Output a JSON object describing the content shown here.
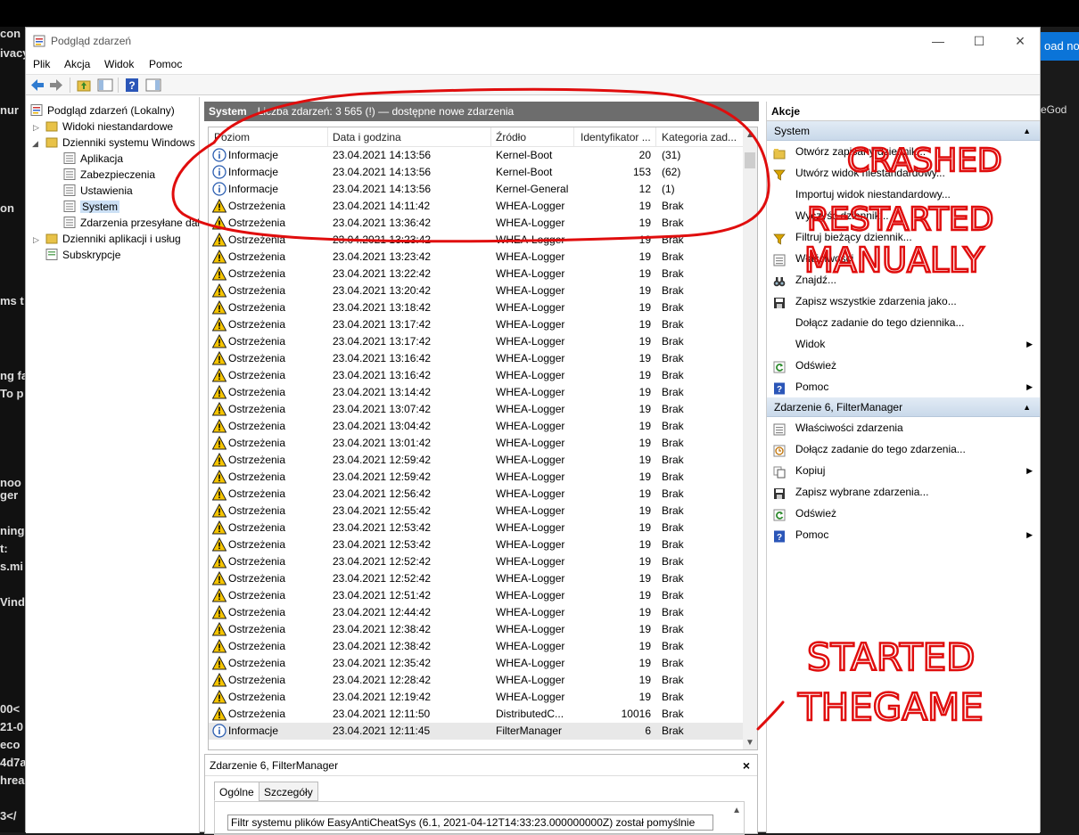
{
  "background": {
    "left_fragments": [
      "con",
      "ivacy",
      "nur",
      "on",
      "ms t",
      "ng fa",
      "To p",
      "noo",
      "ger",
      "ning",
      "t:",
      "s.mi",
      "Vind",
      "00<",
      "21-0",
      "eco",
      "4d7a",
      "hrea",
      "3</"
    ],
    "right_button": "oad no",
    "right_text": "eGod"
  },
  "window": {
    "title": "Podgląd zdarzeń",
    "menu": [
      "Plik",
      "Akcja",
      "Widok",
      "Pomoc"
    ]
  },
  "tree": {
    "root": "Podgląd zdarzeń (Lokalny)",
    "custom_views": "Widoki niestandardowe",
    "windows_logs": "Dzienniki systemu Windows",
    "logs": [
      "Aplikacja",
      "Zabezpieczenia",
      "Ustawienia",
      "System",
      "Zdarzenia przesyłane dalej"
    ],
    "app_logs": "Dzienniki aplikacji i usług",
    "subscriptions": "Subskrypcje"
  },
  "center": {
    "log_name": "System",
    "count_text": "Liczba zdarzeń: 3 565 (!) — dostępne nowe zdarzenia",
    "columns": [
      "Poziom",
      "Data i godzina",
      "Źródło",
      "Identyfikator ...",
      "Kategoria zad..."
    ],
    "rows": [
      {
        "level": "Informacje",
        "type": "info",
        "date": "23.04.2021 14:13:56",
        "source": "Kernel-Boot",
        "id": "20",
        "category": "(31)"
      },
      {
        "level": "Informacje",
        "type": "info",
        "date": "23.04.2021 14:13:56",
        "source": "Kernel-Boot",
        "id": "153",
        "category": "(62)"
      },
      {
        "level": "Informacje",
        "type": "info",
        "date": "23.04.2021 14:13:56",
        "source": "Kernel-General",
        "id": "12",
        "category": "(1)"
      },
      {
        "level": "Ostrzeżenia",
        "type": "warn",
        "date": "23.04.2021 14:11:42",
        "source": "WHEA-Logger",
        "id": "19",
        "category": "Brak"
      },
      {
        "level": "Ostrzeżenia",
        "type": "warn",
        "date": "23.04.2021 13:36:42",
        "source": "WHEA-Logger",
        "id": "19",
        "category": "Brak"
      },
      {
        "level": "Ostrzeżenia",
        "type": "warn",
        "date": "23.04.2021 13:23:42",
        "source": "WHEA-Logger",
        "id": "19",
        "category": "Brak"
      },
      {
        "level": "Ostrzeżenia",
        "type": "warn",
        "date": "23.04.2021 13:23:42",
        "source": "WHEA-Logger",
        "id": "19",
        "category": "Brak"
      },
      {
        "level": "Ostrzeżenia",
        "type": "warn",
        "date": "23.04.2021 13:22:42",
        "source": "WHEA-Logger",
        "id": "19",
        "category": "Brak"
      },
      {
        "level": "Ostrzeżenia",
        "type": "warn",
        "date": "23.04.2021 13:20:42",
        "source": "WHEA-Logger",
        "id": "19",
        "category": "Brak"
      },
      {
        "level": "Ostrzeżenia",
        "type": "warn",
        "date": "23.04.2021 13:18:42",
        "source": "WHEA-Logger",
        "id": "19",
        "category": "Brak"
      },
      {
        "level": "Ostrzeżenia",
        "type": "warn",
        "date": "23.04.2021 13:17:42",
        "source": "WHEA-Logger",
        "id": "19",
        "category": "Brak"
      },
      {
        "level": "Ostrzeżenia",
        "type": "warn",
        "date": "23.04.2021 13:17:42",
        "source": "WHEA-Logger",
        "id": "19",
        "category": "Brak"
      },
      {
        "level": "Ostrzeżenia",
        "type": "warn",
        "date": "23.04.2021 13:16:42",
        "source": "WHEA-Logger",
        "id": "19",
        "category": "Brak"
      },
      {
        "level": "Ostrzeżenia",
        "type": "warn",
        "date": "23.04.2021 13:16:42",
        "source": "WHEA-Logger",
        "id": "19",
        "category": "Brak"
      },
      {
        "level": "Ostrzeżenia",
        "type": "warn",
        "date": "23.04.2021 13:14:42",
        "source": "WHEA-Logger",
        "id": "19",
        "category": "Brak"
      },
      {
        "level": "Ostrzeżenia",
        "type": "warn",
        "date": "23.04.2021 13:07:42",
        "source": "WHEA-Logger",
        "id": "19",
        "category": "Brak"
      },
      {
        "level": "Ostrzeżenia",
        "type": "warn",
        "date": "23.04.2021 13:04:42",
        "source": "WHEA-Logger",
        "id": "19",
        "category": "Brak"
      },
      {
        "level": "Ostrzeżenia",
        "type": "warn",
        "date": "23.04.2021 13:01:42",
        "source": "WHEA-Logger",
        "id": "19",
        "category": "Brak"
      },
      {
        "level": "Ostrzeżenia",
        "type": "warn",
        "date": "23.04.2021 12:59:42",
        "source": "WHEA-Logger",
        "id": "19",
        "category": "Brak"
      },
      {
        "level": "Ostrzeżenia",
        "type": "warn",
        "date": "23.04.2021 12:59:42",
        "source": "WHEA-Logger",
        "id": "19",
        "category": "Brak"
      },
      {
        "level": "Ostrzeżenia",
        "type": "warn",
        "date": "23.04.2021 12:56:42",
        "source": "WHEA-Logger",
        "id": "19",
        "category": "Brak"
      },
      {
        "level": "Ostrzeżenia",
        "type": "warn",
        "date": "23.04.2021 12:55:42",
        "source": "WHEA-Logger",
        "id": "19",
        "category": "Brak"
      },
      {
        "level": "Ostrzeżenia",
        "type": "warn",
        "date": "23.04.2021 12:53:42",
        "source": "WHEA-Logger",
        "id": "19",
        "category": "Brak"
      },
      {
        "level": "Ostrzeżenia",
        "type": "warn",
        "date": "23.04.2021 12:53:42",
        "source": "WHEA-Logger",
        "id": "19",
        "category": "Brak"
      },
      {
        "level": "Ostrzeżenia",
        "type": "warn",
        "date": "23.04.2021 12:52:42",
        "source": "WHEA-Logger",
        "id": "19",
        "category": "Brak"
      },
      {
        "level": "Ostrzeżenia",
        "type": "warn",
        "date": "23.04.2021 12:52:42",
        "source": "WHEA-Logger",
        "id": "19",
        "category": "Brak"
      },
      {
        "level": "Ostrzeżenia",
        "type": "warn",
        "date": "23.04.2021 12:51:42",
        "source": "WHEA-Logger",
        "id": "19",
        "category": "Brak"
      },
      {
        "level": "Ostrzeżenia",
        "type": "warn",
        "date": "23.04.2021 12:44:42",
        "source": "WHEA-Logger",
        "id": "19",
        "category": "Brak"
      },
      {
        "level": "Ostrzeżenia",
        "type": "warn",
        "date": "23.04.2021 12:38:42",
        "source": "WHEA-Logger",
        "id": "19",
        "category": "Brak"
      },
      {
        "level": "Ostrzeżenia",
        "type": "warn",
        "date": "23.04.2021 12:38:42",
        "source": "WHEA-Logger",
        "id": "19",
        "category": "Brak"
      },
      {
        "level": "Ostrzeżenia",
        "type": "warn",
        "date": "23.04.2021 12:35:42",
        "source": "WHEA-Logger",
        "id": "19",
        "category": "Brak"
      },
      {
        "level": "Ostrzeżenia",
        "type": "warn",
        "date": "23.04.2021 12:28:42",
        "source": "WHEA-Logger",
        "id": "19",
        "category": "Brak"
      },
      {
        "level": "Ostrzeżenia",
        "type": "warn",
        "date": "23.04.2021 12:19:42",
        "source": "WHEA-Logger",
        "id": "19",
        "category": "Brak"
      },
      {
        "level": "Ostrzeżenia",
        "type": "warn",
        "date": "23.04.2021 12:11:50",
        "source": "DistributedC...",
        "id": "10016",
        "category": "Brak"
      },
      {
        "level": "Informacje",
        "type": "info",
        "date": "23.04.2021 12:11:45",
        "source": "FilterManager",
        "id": "6",
        "category": "Brak",
        "selected": true
      }
    ]
  },
  "detail": {
    "title": "Zdarzenie 6, FilterManager",
    "tabs": [
      "Ogólne",
      "Szczegóły"
    ],
    "text": "Filtr systemu plików EasyAntiCheatSys (6.1, 2021-04-12T14:33:23.000000000Z) został pomyślnie"
  },
  "actions": {
    "title": "Akcje",
    "section1": "System",
    "items1": [
      {
        "label": "Otwórz zapisany dziennik...",
        "icon": "folder-open-icon"
      },
      {
        "label": "Utwórz widok niestandardowy...",
        "icon": "filter-icon"
      },
      {
        "label": "Importuj widok niestandardowy...",
        "icon": "none"
      },
      {
        "label": "Wyczyść dziennik...",
        "icon": "none"
      },
      {
        "label": "Filtruj bieżący dziennik...",
        "icon": "filter-icon"
      },
      {
        "label": "Właściwości",
        "icon": "properties-icon"
      },
      {
        "label": "Znajdź...",
        "icon": "binoculars-icon"
      },
      {
        "label": "Zapisz wszystkie zdarzenia jako...",
        "icon": "save-icon"
      },
      {
        "label": "Dołącz zadanie do tego dziennika...",
        "icon": "none"
      },
      {
        "label": "Widok",
        "icon": "none",
        "submenu": true
      },
      {
        "label": "Odśwież",
        "icon": "refresh-icon"
      },
      {
        "label": "Pomoc",
        "icon": "help-icon",
        "submenu": true
      }
    ],
    "section2": "Zdarzenie 6, FilterManager",
    "items2": [
      {
        "label": "Właściwości zdarzenia",
        "icon": "properties-icon"
      },
      {
        "label": "Dołącz zadanie do tego zdarzenia...",
        "icon": "task-icon"
      },
      {
        "label": "Kopiuj",
        "icon": "copy-icon",
        "submenu": true
      },
      {
        "label": "Zapisz wybrane zdarzenia...",
        "icon": "save-icon"
      },
      {
        "label": "Odśwież",
        "icon": "refresh-icon"
      },
      {
        "label": "Pomoc",
        "icon": "help-icon",
        "submenu": true
      }
    ]
  },
  "annotations": {
    "line1": "CRASHED",
    "line2": "RESTARTED",
    "line3": "MANUALLY",
    "line4": "STARTED",
    "line5": "THEGAME",
    "color": "#e00d0d"
  }
}
